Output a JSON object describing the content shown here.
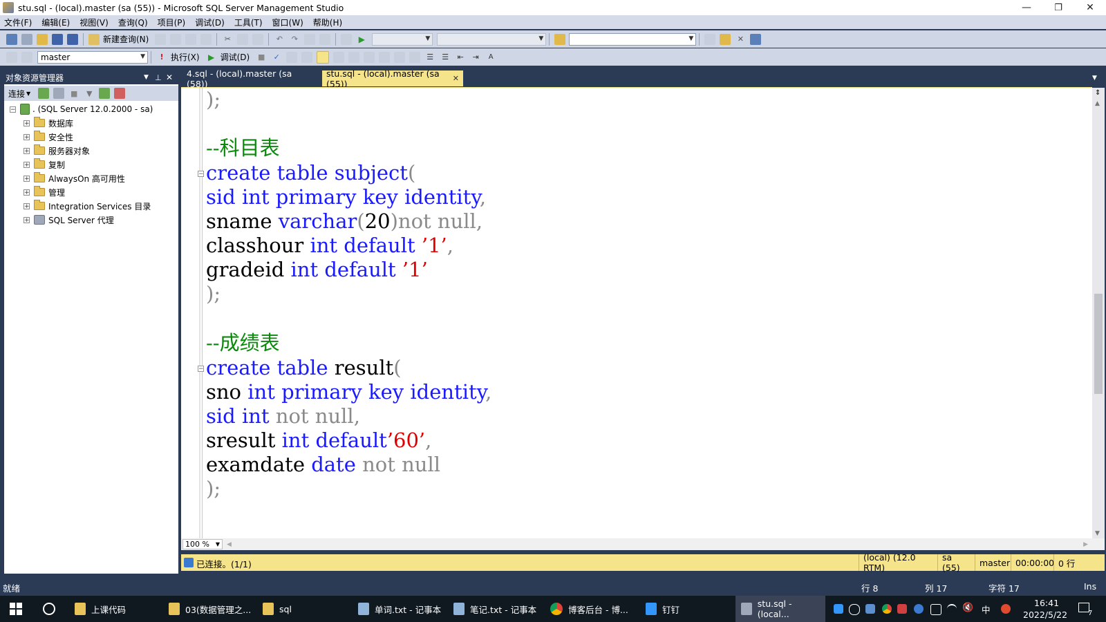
{
  "window": {
    "title": "stu.sql - (local).master (sa (55)) - Microsoft SQL Server Management Studio",
    "minimize": "—",
    "restore": "❐",
    "close": "✕"
  },
  "menu": [
    "文件(F)",
    "编辑(E)",
    "视图(V)",
    "查询(Q)",
    "项目(P)",
    "调试(D)",
    "工具(T)",
    "窗口(W)",
    "帮助(H)"
  ],
  "toolbar1": {
    "new_query": "新建查询(N)"
  },
  "toolbar2": {
    "database": "master",
    "execute": "执行(X)",
    "debug": "调试(D)"
  },
  "object_explorer": {
    "title": "对象资源管理器",
    "connect": "连接",
    "server": ". (SQL Server 12.0.2000 - sa)",
    "nodes": [
      "数据库",
      "安全性",
      "服务器对象",
      "复制",
      "AlwaysOn 高可用性",
      "管理",
      "Integration Services 目录",
      "SQL Server 代理"
    ]
  },
  "tabs": [
    {
      "label": "4.sql - (local).master (sa (58))",
      "active": false
    },
    {
      "label": "stu.sql - (local).master (sa (55))",
      "active": true
    }
  ],
  "tab_close": "✕",
  "code": {
    "l1_close": ");",
    "comment_subject": "--科目表",
    "subject_create": "create table",
    "subject_name": "subject",
    "paren_open": "(",
    "sid": "sid",
    "int": "int",
    "primary_key_identity": "primary key identity",
    "comma": ",",
    "sname": "sname",
    "varchar": "varchar",
    "twenty": "20",
    "paren_close": ")",
    "not_null": "not null",
    "classhour": "classhour",
    "default": "default",
    "val1": "’1’",
    "gradeid": "gradeid",
    "close2": ");",
    "comment_result": "--成绩表",
    "result_name": "result",
    "sno": "sno",
    "sresult": "sresult",
    "val60": "’60’",
    "examdate": "examdate",
    "date": "date",
    "close3": ");"
  },
  "zoom": "100 %",
  "query_status": {
    "connected": "已连接。(1/1)",
    "server": "(local) (12.0 RTM)",
    "user": "sa (55)",
    "db": "master",
    "time": "00:00:00",
    "rows": "0 行"
  },
  "statusbar": {
    "ready": "就绪",
    "row": "行 8",
    "col": "列 17",
    "ch": "字符 17",
    "ins": "Ins"
  },
  "taskbar": {
    "tasks": [
      "上课代码",
      "03(数据管理之...",
      "sql",
      "单词.txt - 记事本",
      "笔记.txt - 记事本",
      "博客后台 - 博...",
      "钉钉",
      "stu.sql - (local..."
    ],
    "ime": "中",
    "time": "16:41",
    "date": "2022/5/22",
    "notif_count": "7"
  },
  "colors": {
    "chrome": "#2b3a55",
    "toolbar": "#cfd6e5",
    "active_tab": "#f5e48a",
    "keyword": "#1a1aff",
    "comment": "#0a8a0a",
    "string": "#e00000"
  }
}
